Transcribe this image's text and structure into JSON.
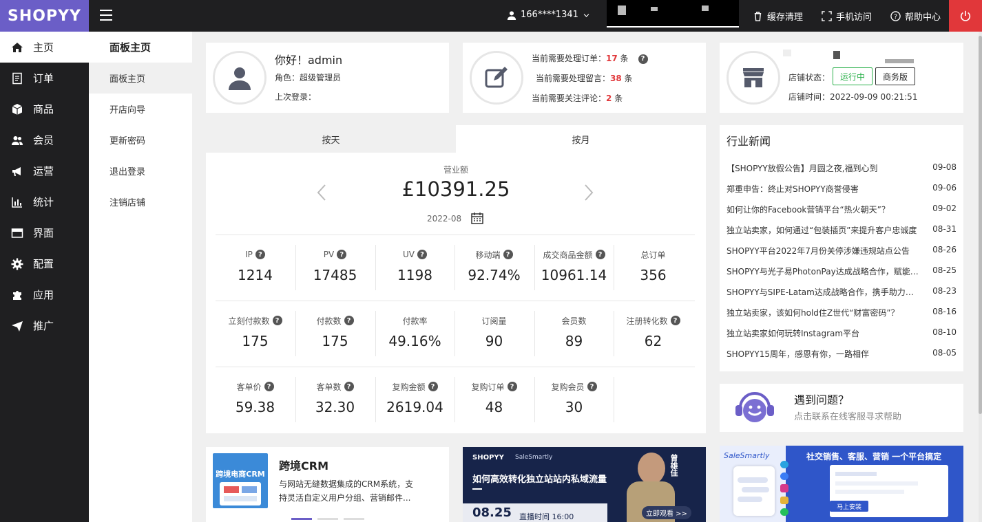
{
  "topbar": {
    "logo": "SHOPYY",
    "user": "166****1341",
    "cache": "缓存清理",
    "mobile": "手机访问",
    "help": "帮助中心"
  },
  "sidebar": {
    "items": [
      {
        "label": "主页",
        "icon": "home-icon"
      },
      {
        "label": "订单",
        "icon": "order-icon"
      },
      {
        "label": "商品",
        "icon": "box-icon"
      },
      {
        "label": "会员",
        "icon": "users-icon"
      },
      {
        "label": "运营",
        "icon": "megaphone-icon"
      },
      {
        "label": "统计",
        "icon": "chart-icon"
      },
      {
        "label": "界面",
        "icon": "layout-icon"
      },
      {
        "label": "配置",
        "icon": "gear-icon"
      },
      {
        "label": "应用",
        "icon": "puzzle-icon"
      },
      {
        "label": "推广",
        "icon": "send-icon"
      }
    ]
  },
  "subnav": {
    "title": "面板主页",
    "items": [
      "面板主页",
      "开店向导",
      "更新密码",
      "退出登录",
      "注销店铺"
    ]
  },
  "profile": {
    "greeting": "你好！admin",
    "role": "角色：超级管理员",
    "last_login": "上次登录："
  },
  "todo": {
    "orders_label": "当前需要处理订单：",
    "orders": "17",
    "messages_label": "当前需要处理留言：",
    "messages": "38",
    "reviews_label": "当前需要关注评论：",
    "reviews": "2",
    "unit": "条"
  },
  "store": {
    "status_label": "店铺状态：",
    "status": "运行中",
    "edition": "商务版",
    "time": "店铺时间：2022-09-09 00:21:51"
  },
  "stats": {
    "tab_day": "按天",
    "tab_month": "按月",
    "revenue_label": "营业额",
    "revenue": "£10391.25",
    "period": "2022-08",
    "row1": [
      {
        "label": "IP",
        "value": "1214",
        "q": true
      },
      {
        "label": "PV",
        "value": "17485",
        "q": true
      },
      {
        "label": "UV",
        "value": "1198",
        "q": true
      },
      {
        "label": "移动端",
        "value": "92.74%",
        "q": true
      },
      {
        "label": "成交商品金额",
        "value": "10961.14",
        "q": true
      },
      {
        "label": "总订单",
        "value": "356",
        "q": false
      }
    ],
    "row2": [
      {
        "label": "立刻付款数",
        "value": "175",
        "q": true
      },
      {
        "label": "付款数",
        "value": "175",
        "q": true
      },
      {
        "label": "付款率",
        "value": "49.16%",
        "q": false
      },
      {
        "label": "订阅量",
        "value": "90",
        "q": false
      },
      {
        "label": "会员数",
        "value": "89",
        "q": false
      },
      {
        "label": "注册转化数",
        "value": "62",
        "q": true
      }
    ],
    "row3": [
      {
        "label": "客单价",
        "value": "59.38",
        "q": true
      },
      {
        "label": "客单数",
        "value": "32.30",
        "q": true
      },
      {
        "label": "复购金额",
        "value": "2619.04",
        "q": true
      },
      {
        "label": "复购订单",
        "value": "48",
        "q": true
      },
      {
        "label": "复购会员",
        "value": "30",
        "q": true
      }
    ]
  },
  "news": {
    "title": "行业新闻",
    "items": [
      {
        "title": "【SHOPYY放假公告】月圆之夜,福到心到",
        "date": "09-08"
      },
      {
        "title": "郑重申告：终止对SHOPYY商誉侵害",
        "date": "09-06"
      },
      {
        "title": "如何让你的Facebook营销平台“热火朝天”？",
        "date": "09-02"
      },
      {
        "title": "独立站卖家，如何通过“包装插页”来提升客户忠诚度",
        "date": "08-31"
      },
      {
        "title": "SHOPYY平台2022年7月份关停涉嫌违规站点公告",
        "date": "08-26"
      },
      {
        "title": "SHOPYY与光子易PhotonPay达成战略合作，赋能跨境",
        "date": "08-25"
      },
      {
        "title": "SHOPYY与SIPE-Latam达成战略合作，携手助力拉美",
        "date": "08-23"
      },
      {
        "title": "独立站卖家，该如何hold住Z世代“财富密码”？",
        "date": "08-16"
      },
      {
        "title": "独立站卖家如何玩转Instagram平台",
        "date": "08-10"
      },
      {
        "title": "SHOPYY15周年，感恩有你，一路相伴",
        "date": "08-05"
      }
    ]
  },
  "support": {
    "title": "遇到问题？",
    "desc": "点击联系在线客服寻求帮助"
  },
  "crm": {
    "title": "跨境CRM",
    "img_text": "跨境电商CRM",
    "desc": "与网站无缝数据集成的CRM系统，支持灵活自定义用户分组、营销邮件..."
  },
  "banner1": {
    "brand": "SHOPYY",
    "partner": "SaleSmartly",
    "headline": "如何高效转化独立站站内私域流量",
    "date": "08.25",
    "time": "直播时间 16:00",
    "name": "曾雄佳",
    "cta": "立即观看 >>"
  },
  "banner2": {
    "brand": "SaleSmartly",
    "headline": "社交销售、客服、营销 一个平台搞定",
    "cta": "马上安装"
  }
}
